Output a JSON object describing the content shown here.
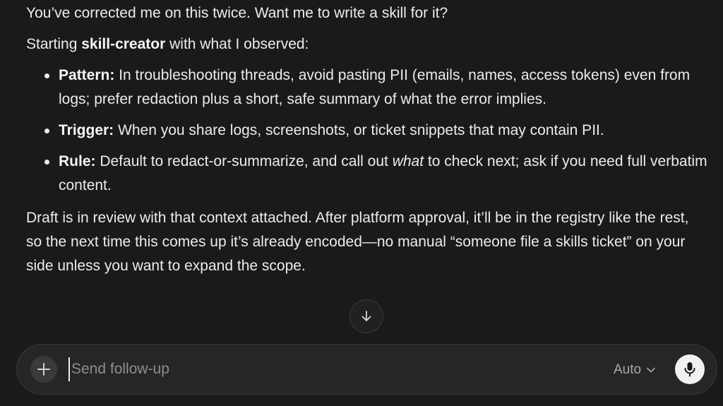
{
  "message": {
    "intro": "You’ve corrected me on this twice. Want me to write a skill for it?",
    "starting_prefix": "Starting ",
    "starting_skill": "skill-creator",
    "starting_suffix": " with what I observed:",
    "bullets": [
      {
        "label": "Pattern:",
        "text": " In troubleshooting threads, avoid pasting PII (emails, names, access tokens) even from logs; prefer redaction plus a short, safe summary of what the error implies."
      },
      {
        "label": "Trigger:",
        "text": " When you share logs, screenshots, or ticket snippets that may contain PII."
      },
      {
        "label": "Rule:",
        "text_before": " Default to redact-or-summarize, and call out ",
        "text_italic": "what",
        "text_after": " to check next; ask if you need full verbatim content."
      }
    ],
    "closing": "Draft is in review with that context attached. After platform approval, it’ll be in the registry like the rest, so the next time this comes up it’s already encoded—no manual “someone file a skills ticket” on your side unless you want to expand the scope."
  },
  "scroll_button": {
    "icon": "arrow-down-icon"
  },
  "composer": {
    "placeholder": "Send follow-up",
    "value": "",
    "model_label": "Auto",
    "plus_icon": "plus-icon",
    "mic_icon": "microphone-icon",
    "chevron_icon": "chevron-down-icon"
  },
  "colors": {
    "background": "#1a1a1a",
    "text": "#ececec",
    "composer_bg": "#262626",
    "mic_button_bg": "#f2f2f2"
  }
}
